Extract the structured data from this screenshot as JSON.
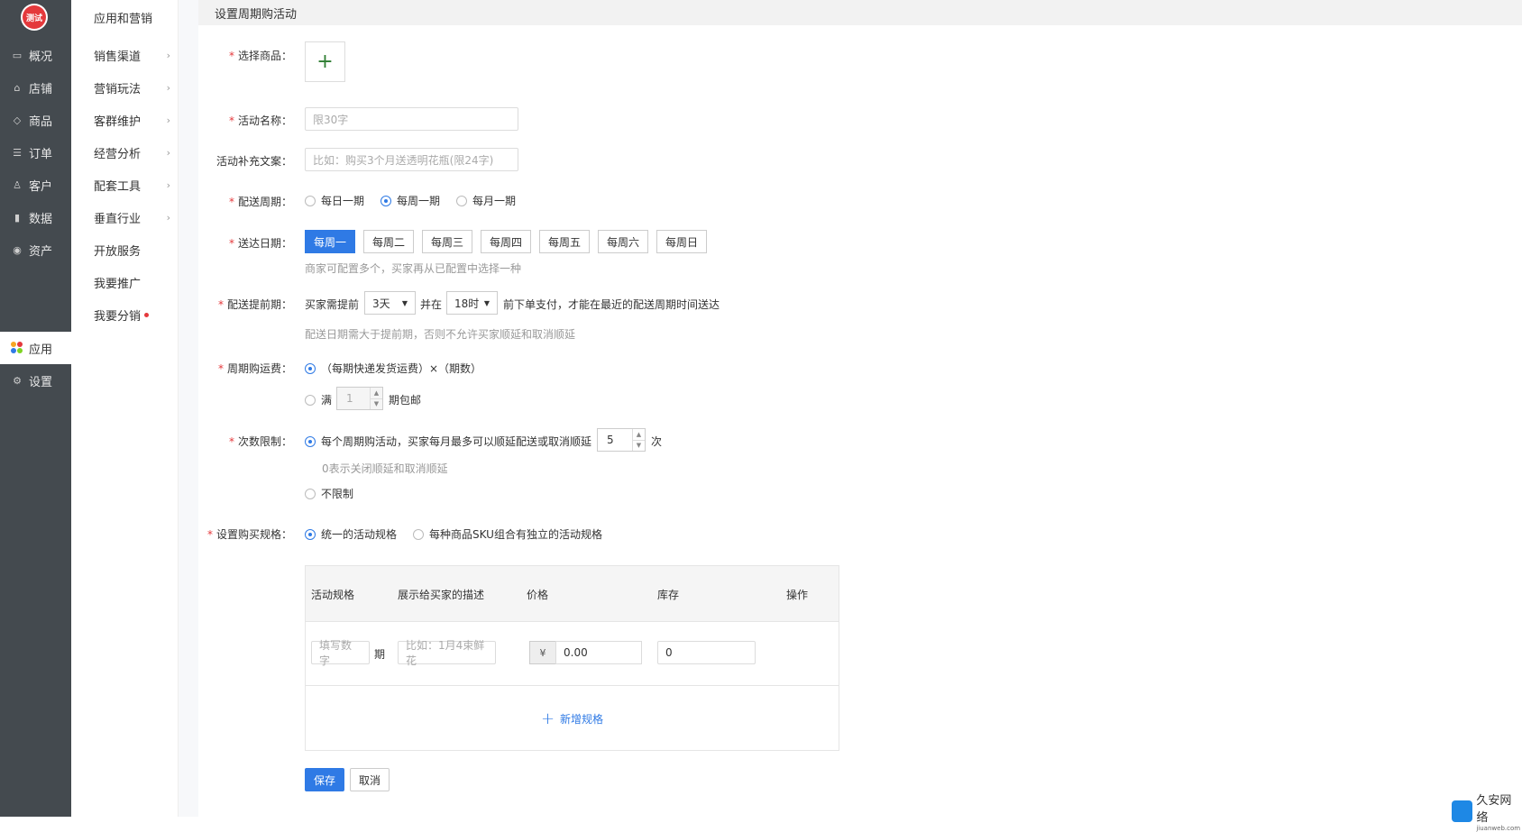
{
  "nav": {
    "logo_text": "测试",
    "items": [
      {
        "label": "概况",
        "icon": "dashboard-icon"
      },
      {
        "label": "店铺",
        "icon": "store-icon"
      },
      {
        "label": "商品",
        "icon": "tag-icon"
      },
      {
        "label": "订单",
        "icon": "order-icon"
      },
      {
        "label": "客户",
        "icon": "user-icon"
      },
      {
        "label": "数据",
        "icon": "chart-icon"
      },
      {
        "label": "资产",
        "icon": "coin-icon"
      },
      {
        "label": "应用",
        "icon": "apps-icon"
      },
      {
        "label": "设置",
        "icon": "gear-icon"
      }
    ],
    "active_index": 7
  },
  "submenu": {
    "header": "应用和营销",
    "items": [
      {
        "label": "销售渠道",
        "has_arrow": true
      },
      {
        "label": "营销玩法",
        "has_arrow": true
      },
      {
        "label": "客群维护",
        "has_arrow": true
      },
      {
        "label": "经营分析",
        "has_arrow": true
      },
      {
        "label": "配套工具",
        "has_arrow": true
      },
      {
        "label": "垂直行业",
        "has_arrow": true
      },
      {
        "label": "开放服务",
        "has_arrow": false
      },
      {
        "label": "我要推广",
        "has_arrow": false
      },
      {
        "label": "我要分销",
        "has_arrow": false
      }
    ]
  },
  "page_title": "设置周期购活动",
  "form": {
    "product": {
      "label": "选择商品："
    },
    "name": {
      "label": "活动名称：",
      "placeholder": "限30字"
    },
    "extra_copy": {
      "label": "活动补充文案：",
      "placeholder": "比如：购买3个月送透明花瓶(限24字)"
    },
    "cycle": {
      "label": "配送周期：",
      "options": [
        "每日一期",
        "每周一期",
        "每月一期"
      ],
      "selected": 1
    },
    "delivery_day": {
      "label": "送达日期：",
      "options": [
        "每周一",
        "每周二",
        "每周三",
        "每周四",
        "每周五",
        "每周六",
        "每周日"
      ],
      "selected": 0,
      "hint": "商家可配置多个，买家再从已配置中选择一种"
    },
    "lead_time": {
      "label": "配送提前期：",
      "prefix": "买家需提前",
      "days": "3天",
      "mid": "并在",
      "hour": "18时",
      "suffix": "前下单支付，才能在最近的配送周期时间送达",
      "hint": "配送日期需大于提前期，否则不允许买家顺延和取消顺延"
    },
    "shipping": {
      "label": "周期购运费：",
      "option1": "（每期快递发货运费）×（期数）",
      "option2_prefix": "满",
      "option2_value": "1",
      "option2_suffix": "期包邮"
    },
    "limit": {
      "label": "次数限制：",
      "option1_text": "每个周期购活动，买家每月最多可以顺延配送或取消顺延",
      "value": "5",
      "unit": "次",
      "hint": "0表示关闭顺延和取消顺延",
      "option2": "不限制"
    },
    "spec": {
      "label": "设置购买规格：",
      "options": [
        "统一的活动规格",
        "每种商品SKU组合有独立的活动规格"
      ],
      "selected": 0
    }
  },
  "table": {
    "headers": [
      "活动规格",
      "展示给买家的描述",
      "价格",
      "库存",
      "操作"
    ],
    "row": {
      "period_placeholder": "填写数字",
      "period_unit": "期",
      "desc_placeholder": "比如：1月4束鲜花",
      "currency": "¥",
      "price": "0.00",
      "stock": "0"
    },
    "add_label": "新增规格"
  },
  "actions": {
    "save": "保存",
    "cancel": "取消"
  },
  "watermark": {
    "title": "久安网络",
    "sub": "jiuanweb.com"
  },
  "colors": {
    "accent": "#2f7ae5",
    "required": "#e4393c",
    "nav_bg": "#444a4f"
  }
}
